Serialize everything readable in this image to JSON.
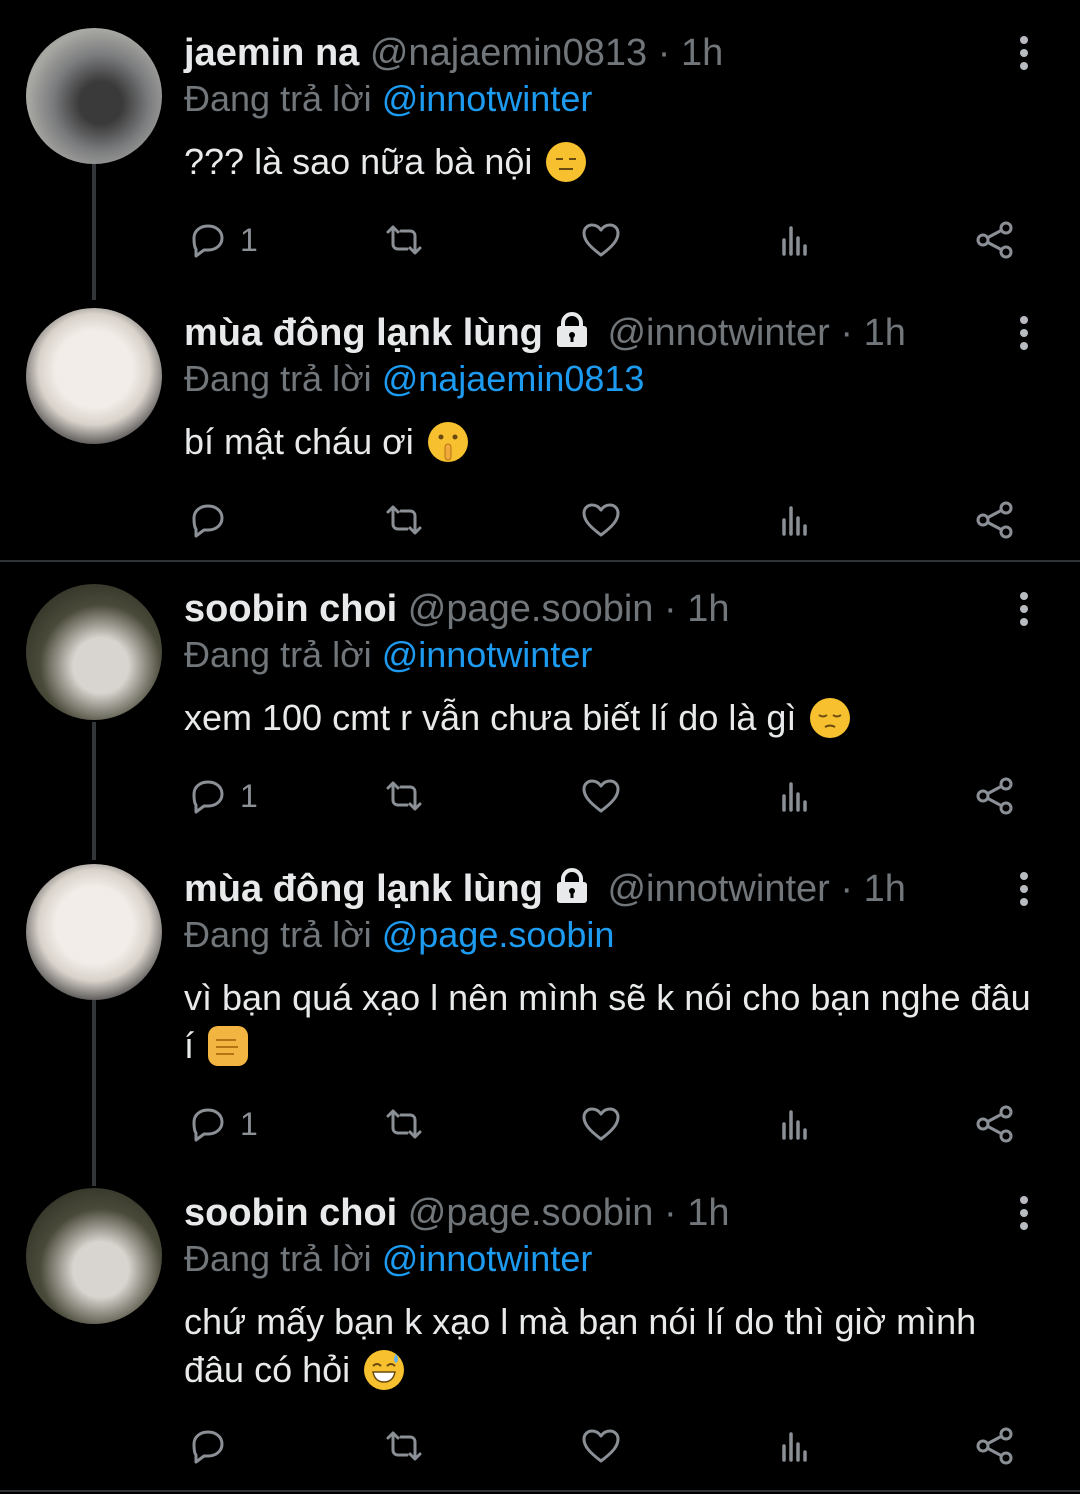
{
  "tweets": [
    {
      "name": "jaemin na",
      "handle": "@najaemin0813",
      "time": "1h",
      "locked": false,
      "reply_prefix": "Đang trả lời",
      "reply_to": "@innotwinter",
      "text": "??? là sao nữa bà nội",
      "emoji": "expressionless-face",
      "reply_count": "1"
    },
    {
      "name": "mùa đông lạnk lùng",
      "handle": "@innotwinter",
      "time": "1h",
      "locked": true,
      "reply_prefix": "Đang trả lời",
      "reply_to": "@najaemin0813",
      "text": "bí mật cháu ơi",
      "emoji": "shushing-face",
      "reply_count": ""
    },
    {
      "name": "soobin choi",
      "handle": "@page.soobin",
      "time": "1h",
      "locked": false,
      "reply_prefix": "Đang trả lời",
      "reply_to": "@innotwinter",
      "text": "xem 100 cmt r vẫn chưa biết lí do là gì",
      "emoji": "pensive-face",
      "reply_count": "1"
    },
    {
      "name": "mùa đông lạnk lùng",
      "handle": "@innotwinter",
      "time": "1h",
      "locked": true,
      "reply_prefix": "Đang trả lời",
      "reply_to": "@page.soobin",
      "text": "vì bạn quá xạo l nên mình sẽ k nói cho bạn nghe đâu í",
      "emoji": "oncoming-fist",
      "reply_count": "1"
    },
    {
      "name": "soobin choi",
      "handle": "@page.soobin",
      "time": "1h",
      "locked": false,
      "reply_prefix": "Đang trả lời",
      "reply_to": "@innotwinter",
      "text": "chứ mấy bạn k xạo l mà bạn nói lí do thì giờ mình đâu có hỏi",
      "emoji": "grinning-face-with-sweat",
      "reply_count": ""
    }
  ],
  "separator": "·",
  "colors": {
    "background": "#000000",
    "text": "#e7e9ea",
    "muted": "#71767b",
    "accent": "#1d9bf0",
    "icon": "#8b9096"
  }
}
